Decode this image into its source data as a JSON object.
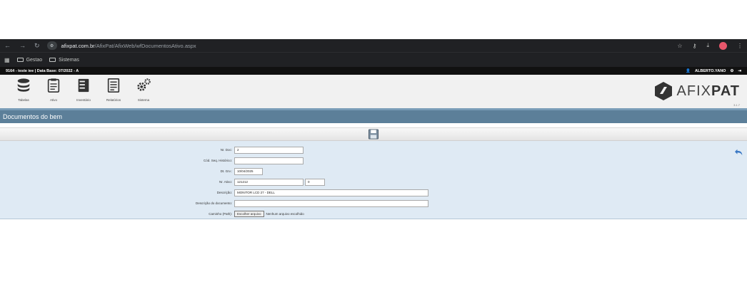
{
  "browser": {
    "url_host": "afixpat.com.br",
    "url_path": "/AfixPat/AfixWeb/wfDocumentosAtivo.aspx",
    "bookmarks": [
      "Gestao",
      "Sistemas"
    ]
  },
  "app_header": {
    "context": "9164 - teste iee | Data Base: 07/2022 - A",
    "user": "ALBERTO.YANO"
  },
  "toolbar": {
    "items": [
      {
        "label": "Tabelas",
        "icon": "database-icon"
      },
      {
        "label": "Ativo",
        "icon": "clipboard-icon"
      },
      {
        "label": "Inventário",
        "icon": "inventory-icon"
      },
      {
        "label": "Relatórios",
        "icon": "report-icon"
      },
      {
        "label": "Sistema",
        "icon": "gears-icon"
      }
    ]
  },
  "logo": {
    "text_light": "AFIX",
    "text_bold": "PAT",
    "version": "3.1.7"
  },
  "page": {
    "title": "Documentos do bem"
  },
  "form": {
    "nr_doc": {
      "label": "Nr. Doc:",
      "value": "2"
    },
    "cod_seq": {
      "label": "Cód. Seq. Histórico:",
      "value": ""
    },
    "dt_grv": {
      "label": "Dt. Grv.:",
      "value": "10/04/2025"
    },
    "nr_ativo": {
      "label": "Nr. Ativo:",
      "value": "121212",
      "value2": "0"
    },
    "descricao": {
      "label": "Descrição:",
      "value": "MONITOR LCD 27 - DELL"
    },
    "descricao_doc": {
      "label": "Descrição do documento:",
      "value": ""
    },
    "caminho": {
      "label": "Caminho (Path):",
      "button": "Escolher arquivo",
      "status": "Nenhum arquivo escolhido"
    }
  },
  "colors": {
    "title_bar": "#5c7f99",
    "form_bg": "#dfeaf4",
    "accent": "#3a78c4"
  }
}
